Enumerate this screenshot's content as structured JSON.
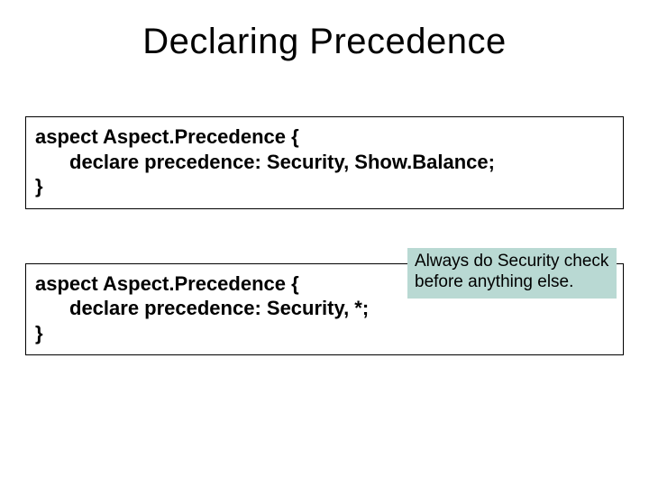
{
  "title": "Declaring Precedence",
  "box1": {
    "line1": "aspect Aspect.Precedence {",
    "line2": "declare precedence: Security, Show.Balance;",
    "line3": "}"
  },
  "box2": {
    "line1": "aspect Aspect.Precedence {",
    "line2": "declare precedence: Security, *;",
    "line3": "}"
  },
  "callout": "Always do Security check before anything else."
}
